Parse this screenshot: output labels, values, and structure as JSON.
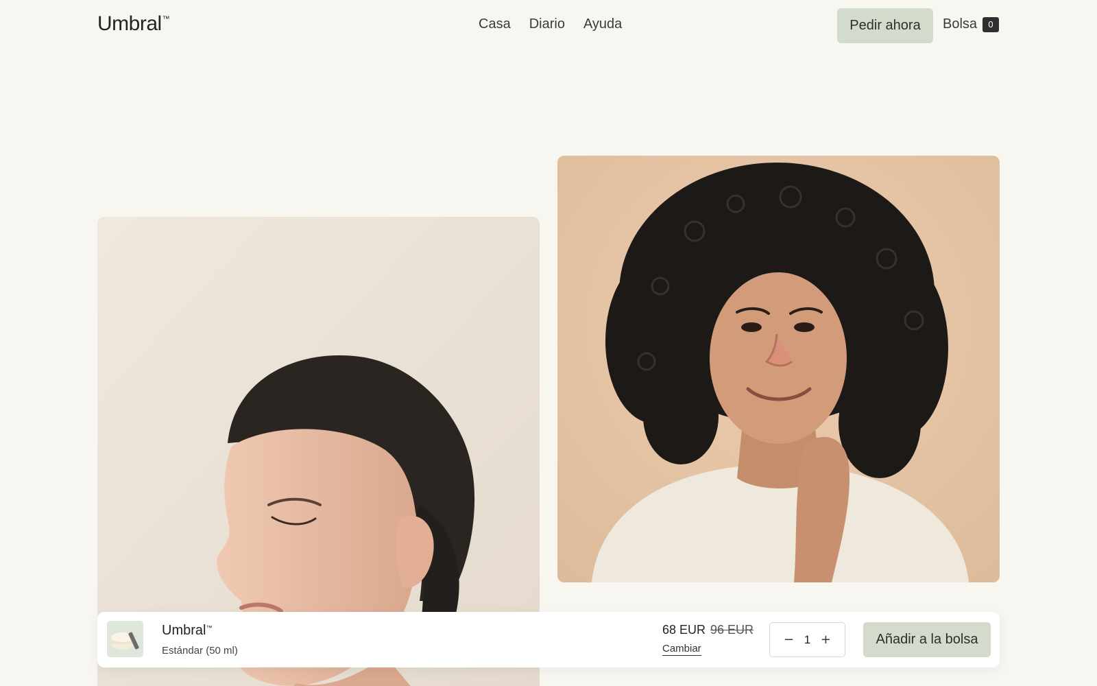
{
  "header": {
    "logo": "Umbral",
    "logo_mark": "™",
    "nav": [
      {
        "label": "Casa"
      },
      {
        "label": "Diario"
      },
      {
        "label": "Ayuda"
      }
    ],
    "order_button": "Pedir ahora",
    "bag_label": "Bolsa",
    "bag_count": "0"
  },
  "buybar": {
    "product_name": "Umbral",
    "product_mark": "™",
    "variant": "Estándar (50 ml)",
    "price": "68 EUR",
    "old_price": "96 EUR",
    "change_link": "Cambiar",
    "quantity": "1",
    "decrement": "−",
    "increment": "+",
    "add_button": "Añadir a la bolsa"
  },
  "colors": {
    "background": "#f8f6f1",
    "accent_button": "#d3dccc",
    "badge": "#2f2f2f"
  }
}
